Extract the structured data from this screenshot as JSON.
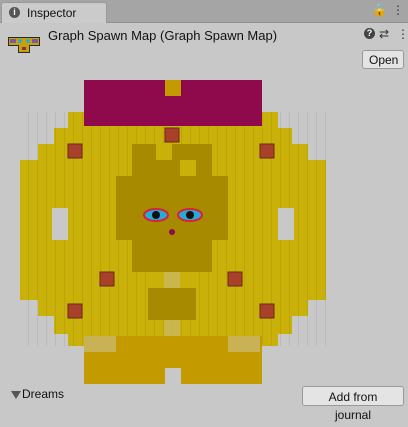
{
  "tab": {
    "icon_glyph": "i",
    "title": "Inspector",
    "lock_glyph": "🔒",
    "menu_glyph": "⋮"
  },
  "header": {
    "title": "Graph Spawn Map (Graph Spawn Map)",
    "help_glyph": "?",
    "settings_glyph": "⇄",
    "more_glyph": "⋮",
    "open_label": "Open"
  },
  "preview": {
    "colors": {
      "background": "#c8c8c8",
      "floor": "#c9b10a",
      "floor_dark": "#a88a00",
      "magenta": "#8e0a4d",
      "bottom_room": "#c39b00",
      "marker": "#a8402a",
      "eye_white": "#2aa8d8",
      "pupil": "#111111",
      "eye_outline": "#d8203a"
    }
  },
  "dreams": {
    "label": "Dreams",
    "add_label": "Add from journal"
  }
}
